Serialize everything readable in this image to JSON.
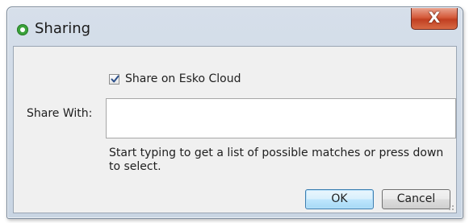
{
  "window": {
    "title": "Sharing",
    "close_label": "X"
  },
  "share_on_cloud": {
    "label": "Share on Esko Cloud",
    "checked": true
  },
  "share_with": {
    "label": "Share With:",
    "value": "",
    "placeholder": ""
  },
  "hint_text": "Start typing to get a list of possible matches or press down to select.",
  "buttons": {
    "ok_label": "OK",
    "cancel_label": "Cancel"
  },
  "icons": {
    "app": "esko-app-icon",
    "close": "close-icon",
    "check": "checkmark-icon"
  },
  "colors": {
    "close_button": "#d55a3a",
    "ok_button_border": "#3c7fb1",
    "app_icon": "#3aa23a"
  }
}
